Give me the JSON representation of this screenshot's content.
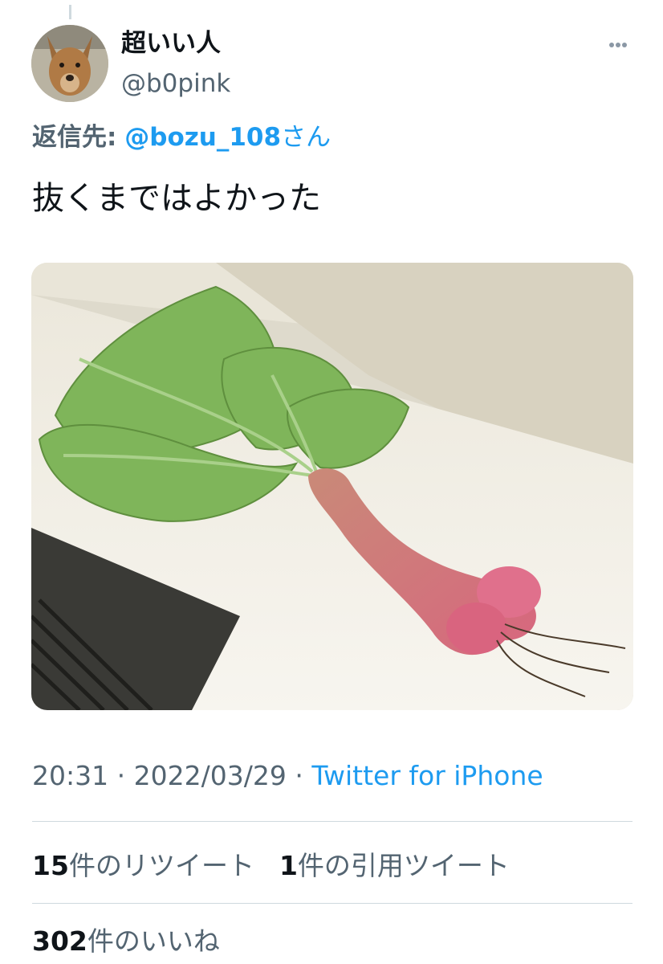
{
  "user": {
    "display_name": "超いい人",
    "handle": "@b0pink"
  },
  "reply": {
    "label": "返信先:",
    "mention": "@bozu_108",
    "suffix": "さん"
  },
  "tweet": {
    "text": "抜くまではよかった",
    "time": "20:31",
    "separator": "·",
    "date": "2022/03/29",
    "app": "Twitter for iPhone"
  },
  "stats": {
    "retweets_count": "15",
    "retweets_label": "件のリツイート",
    "quotes_count": "1",
    "quotes_label": "件の引用ツイート",
    "likes_count": "302",
    "likes_label": "件のいいね"
  },
  "colors": {
    "accent": "#1d9bf0",
    "secondary_text": "#536471",
    "primary_text": "#0f1419",
    "divider": "#cfd9de"
  },
  "icons": {
    "more": "more-dots-icon"
  }
}
